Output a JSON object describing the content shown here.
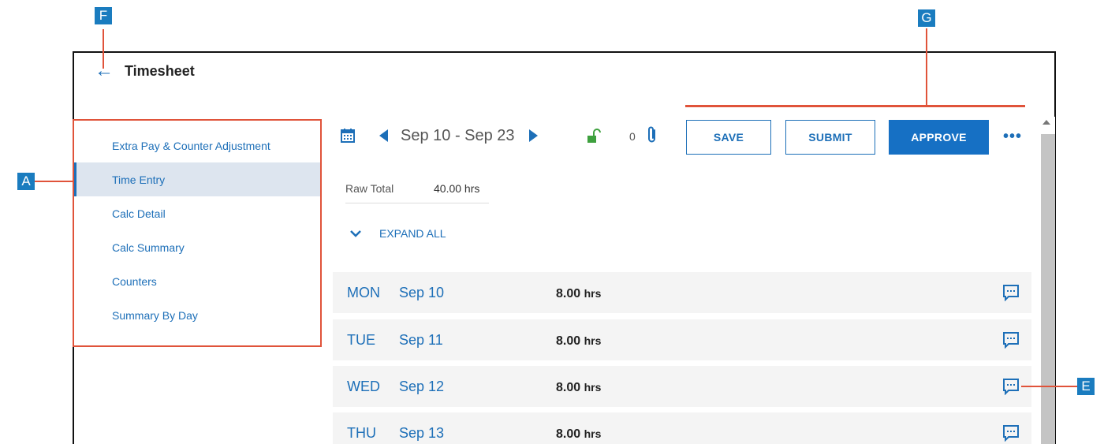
{
  "header": {
    "title": "Timesheet",
    "back_icon": "arrow-left-icon"
  },
  "sidebar": {
    "items": [
      {
        "label": "Extra Pay & Counter Adjustment",
        "active": false
      },
      {
        "label": "Time Entry",
        "active": true
      },
      {
        "label": "Calc Detail",
        "active": false
      },
      {
        "label": "Calc Summary",
        "active": false
      },
      {
        "label": "Counters",
        "active": false
      },
      {
        "label": "Summary By Day",
        "active": false
      }
    ]
  },
  "toolbar": {
    "date_range": "Sep 10 - Sep 23",
    "attachment_count": "0",
    "save_label": "SAVE",
    "submit_label": "SUBMIT",
    "approve_label": "APPROVE",
    "more_label": "•••"
  },
  "summary": {
    "raw_total_label": "Raw Total",
    "raw_total_value": "40.00 hrs"
  },
  "expand_all_label": "EXPAND ALL",
  "days": [
    {
      "dow": "MON",
      "date": "Sep 10",
      "hours": "8.00",
      "unit": "hrs"
    },
    {
      "dow": "TUE",
      "date": "Sep 11",
      "hours": "8.00",
      "unit": "hrs"
    },
    {
      "dow": "WED",
      "date": "Sep 12",
      "hours": "8.00",
      "unit": "hrs"
    },
    {
      "dow": "THU",
      "date": "Sep 13",
      "hours": "8.00",
      "unit": "hrs"
    }
  ],
  "callouts": {
    "a": "A",
    "e": "E",
    "f": "F",
    "g": "G"
  },
  "colors": {
    "accent": "#1d6fb8",
    "approve_bg": "#1670c4",
    "callout_bg": "#1a7cbf",
    "callout_line": "#e0533a",
    "lock_green": "#3ea03e"
  }
}
